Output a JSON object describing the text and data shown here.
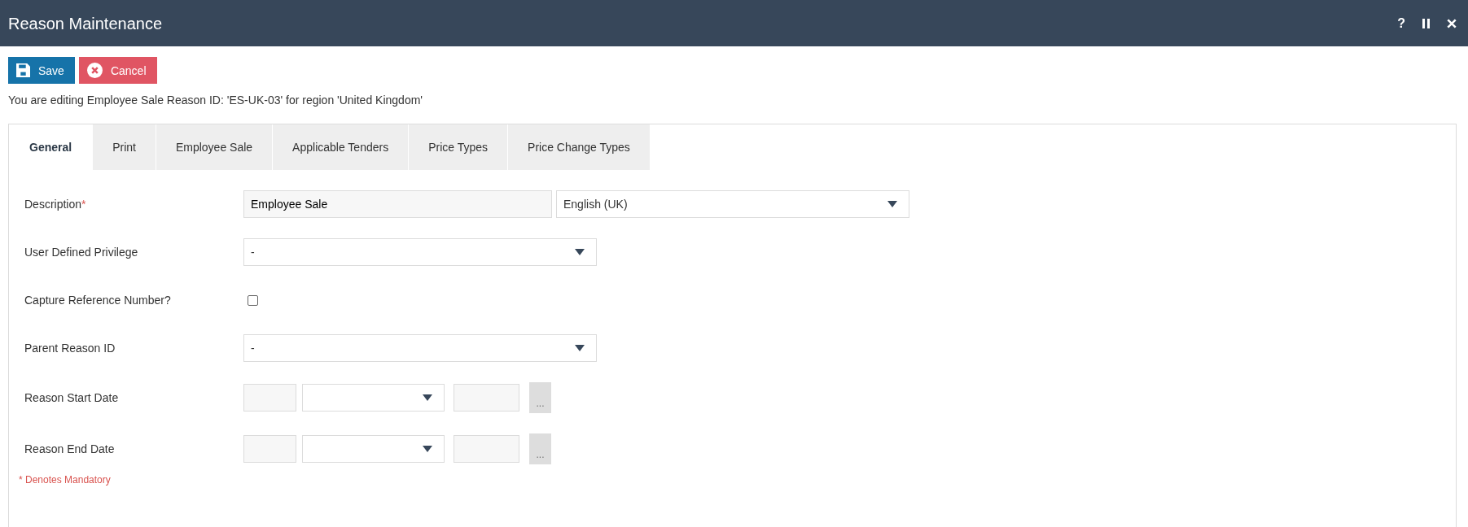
{
  "title_bar": {
    "title": "Reason Maintenance",
    "help": "?"
  },
  "toolbar": {
    "buttons": [
      {
        "kind": "save",
        "label": "Save"
      },
      {
        "kind": "cancel",
        "label": "Cancel"
      }
    ]
  },
  "info": "You are editing Employee Sale Reason ID: 'ES-UK-03' for region 'United Kingdom'",
  "tabs": [
    {
      "label": "General",
      "selected": true
    },
    {
      "label": "Print",
      "selected": false
    },
    {
      "label": "Employee Sale",
      "selected": false
    },
    {
      "label": "Applicable Tenders",
      "selected": false
    },
    {
      "label": "Price Types",
      "selected": false
    },
    {
      "label": "Price Change Types",
      "selected": false
    }
  ],
  "form": {
    "fields": [
      {
        "kind": "text_language",
        "label": "Description",
        "required_mark": "*",
        "value": "Employee Sale",
        "language": "English (UK)"
      },
      {
        "kind": "select",
        "label": "User Defined Privilege",
        "value": "-"
      },
      {
        "kind": "checkbox",
        "label": "Capture Reference Number?",
        "checked": false
      },
      {
        "kind": "select",
        "label": "Parent Reason ID",
        "value": "-"
      },
      {
        "kind": "date",
        "label": "Reason Start Date",
        "picker": "..."
      },
      {
        "kind": "date",
        "label": "Reason End Date",
        "picker": "..."
      }
    ],
    "footnote": "* Denotes Mandatory"
  }
}
